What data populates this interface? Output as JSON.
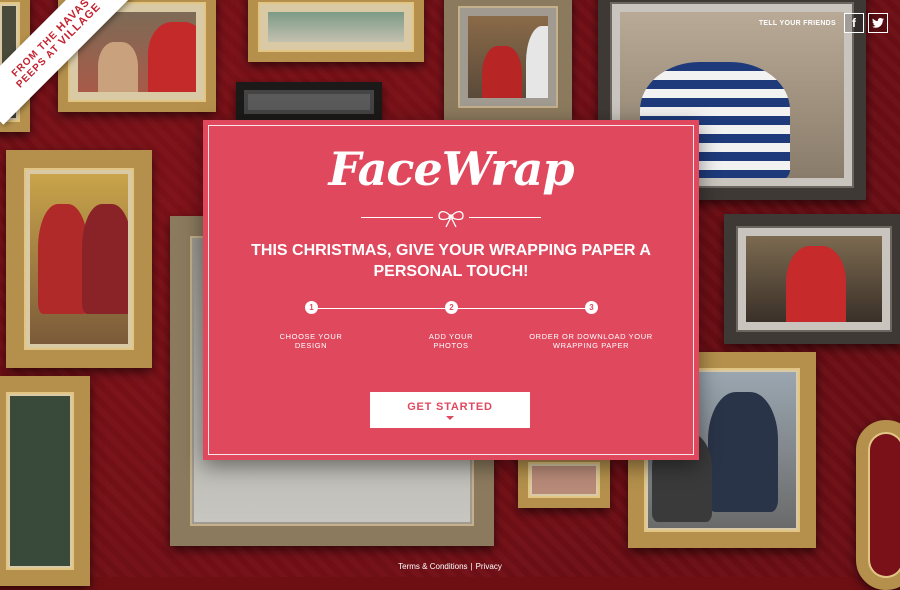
{
  "branding": {
    "ribbon_line1": "FROM THE",
    "ribbon_havas": "HAVAS",
    "ribbon_line2": "PEEPS AT",
    "ribbon_village": "VILLAGE"
  },
  "social": {
    "label": "TELL YOUR FRIENDS",
    "facebook_glyph": "f",
    "twitter_glyph": "🐦"
  },
  "modal": {
    "logo": "FaceWrap",
    "tagline": "THIS CHRISTMAS, GIVE YOUR WRAPPING PAPER A PERSONAL TOUCH!",
    "steps": [
      {
        "number": "1",
        "label": "CHOOSE YOUR DESIGN"
      },
      {
        "number": "2",
        "label": "ADD YOUR PHOTOS"
      },
      {
        "number": "3",
        "label": "ORDER OR DOWNLOAD YOUR WRAPPING PAPER"
      }
    ],
    "cta_label": "GET STARTED"
  },
  "footer": {
    "terms": "Terms & Conditions",
    "separator": "|",
    "privacy": "Privacy"
  },
  "icons": {
    "bow": "bow-icon",
    "facebook": "facebook-icon",
    "twitter": "twitter-icon",
    "caret": "caret-down-icon"
  },
  "colors": {
    "modal_bg": "#e0485e",
    "background": "#7a1118",
    "ribbon_text": "#c4222f"
  }
}
